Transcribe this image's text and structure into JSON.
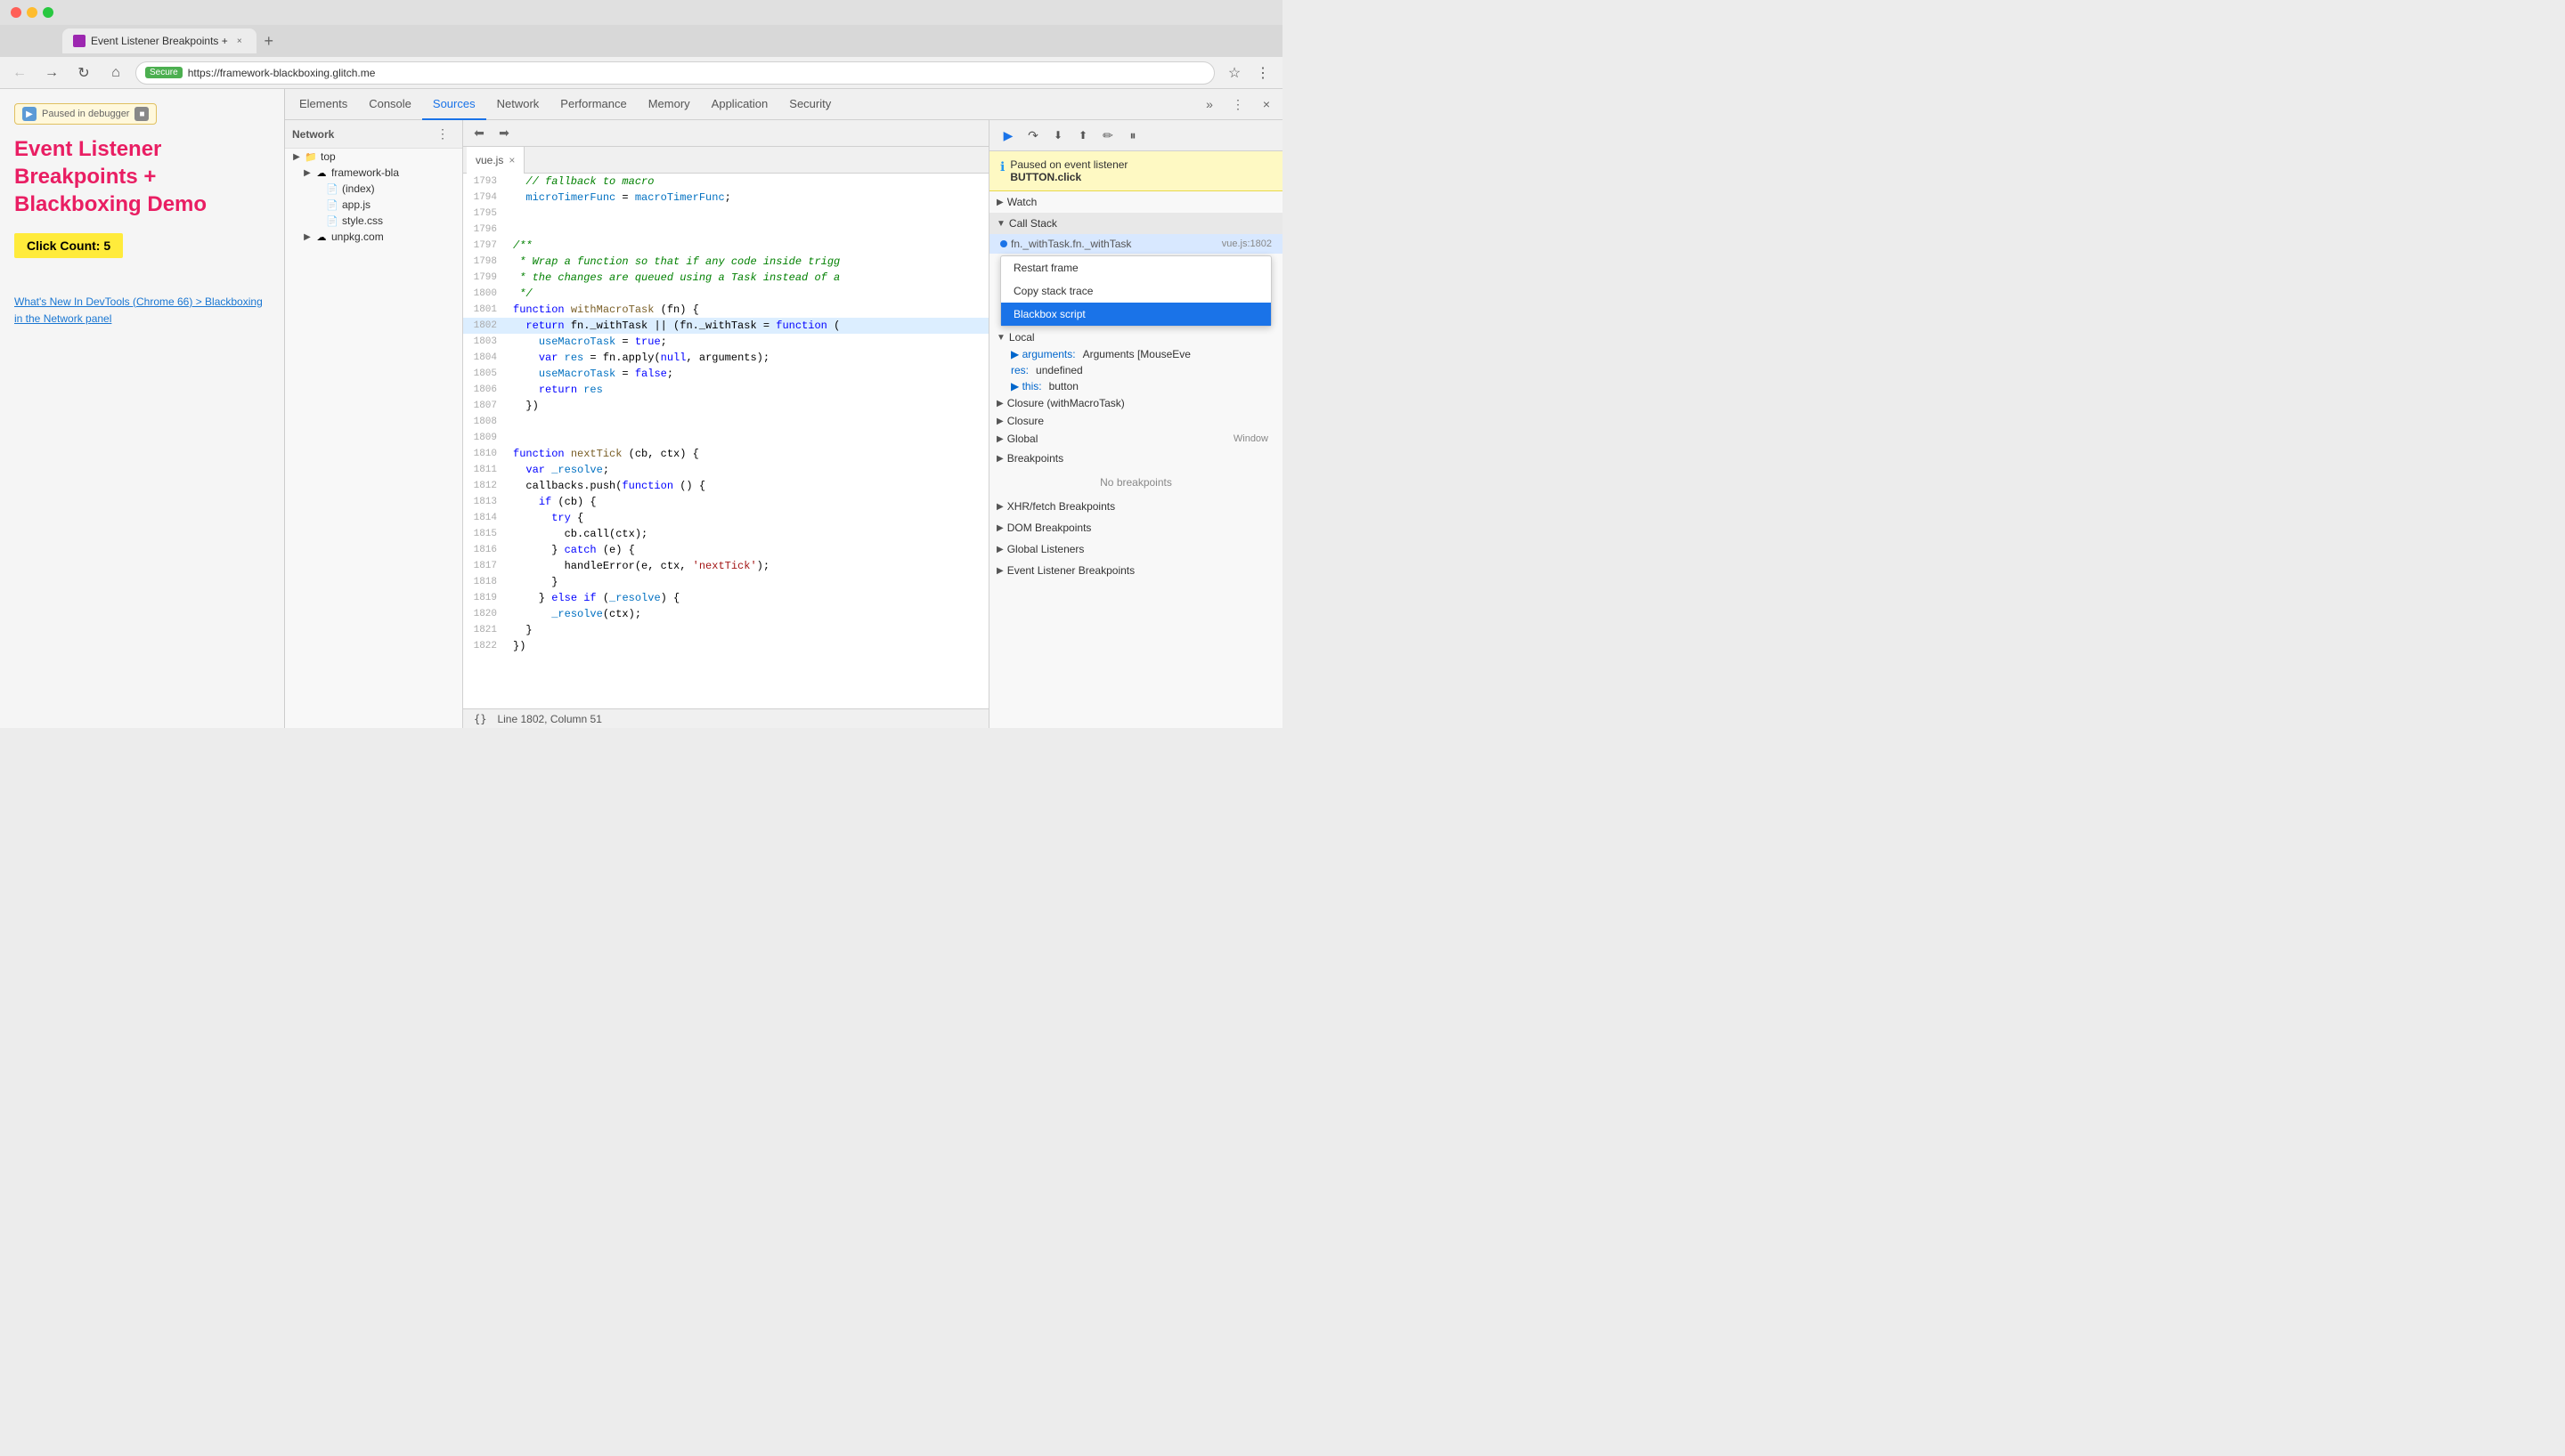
{
  "browser": {
    "tab_title": "Event Listener Breakpoints +",
    "url_secure": "Secure",
    "url": "https://framework-blackboxing.glitch.me",
    "new_tab_label": "+"
  },
  "demo_page": {
    "paused_label": "Paused in debugger",
    "title": "Event Listener Breakpoints + Blackboxing Demo",
    "click_count_label": "Click Count: 5",
    "link1": "What's New In DevTools (Chrome 66) > Blackboxing in the Network panel",
    "link2": ""
  },
  "devtools_tabs": {
    "items": [
      "Elements",
      "Console",
      "Sources",
      "Network",
      "Performance",
      "Memory",
      "Application",
      "Security"
    ],
    "active": "Sources"
  },
  "sources": {
    "network_label": "Network",
    "sidebar_items": [
      {
        "label": "top",
        "indent": 0,
        "arrow": "▶",
        "icon": "📁",
        "type": "folder"
      },
      {
        "label": "framework-bla",
        "indent": 1,
        "arrow": "▶",
        "icon": "☁",
        "type": "cloud"
      },
      {
        "label": "(index)",
        "indent": 2,
        "arrow": "",
        "icon": "📄",
        "type": "file"
      },
      {
        "label": "app.js",
        "indent": 2,
        "arrow": "",
        "icon": "📄",
        "type": "file"
      },
      {
        "label": "style.css",
        "indent": 2,
        "arrow": "",
        "icon": "📄",
        "type": "file"
      },
      {
        "label": "unpkg.com",
        "indent": 1,
        "arrow": "▶",
        "icon": "☁",
        "type": "cloud-closed"
      }
    ],
    "editor_tab": "vue.js",
    "code_lines": [
      {
        "num": "1793",
        "content": "  // fallback to macro",
        "type": "comment"
      },
      {
        "num": "1794",
        "content": "  microTimerFunc = macroTimerFunc;",
        "type": "normal"
      },
      {
        "num": "1795",
        "content": "",
        "type": "normal"
      },
      {
        "num": "1796",
        "content": "",
        "type": "normal"
      },
      {
        "num": "1797",
        "content": "/**",
        "type": "comment"
      },
      {
        "num": "1798",
        "content": " * Wrap a function so that if any code inside trigg",
        "type": "comment"
      },
      {
        "num": "1799",
        "content": " * the changes are queued using a Task instead of a",
        "type": "comment"
      },
      {
        "num": "1800",
        "content": " */",
        "type": "comment"
      },
      {
        "num": "1801",
        "content": "function withMacroTask (fn) {",
        "type": "normal"
      },
      {
        "num": "1802",
        "content": "  return fn._withTask || (fn._withTask = function (",
        "type": "highlighted"
      },
      {
        "num": "1803",
        "content": "    useMacroTask = true;",
        "type": "normal"
      },
      {
        "num": "1804",
        "content": "    var res = fn.apply(null, arguments);",
        "type": "normal"
      },
      {
        "num": "1805",
        "content": "    useMacroTask = false;",
        "type": "normal"
      },
      {
        "num": "1806",
        "content": "    return res",
        "type": "normal"
      },
      {
        "num": "1807",
        "content": "  })",
        "type": "normal"
      },
      {
        "num": "1808",
        "content": "",
        "type": "normal"
      },
      {
        "num": "1809",
        "content": "",
        "type": "normal"
      },
      {
        "num": "1810",
        "content": "function nextTick (cb, ctx) {",
        "type": "normal"
      },
      {
        "num": "1811",
        "content": "  var _resolve;",
        "type": "normal"
      },
      {
        "num": "1812",
        "content": "  callbacks.push(function () {",
        "type": "normal"
      },
      {
        "num": "1813",
        "content": "    if (cb) {",
        "type": "normal"
      },
      {
        "num": "1814",
        "content": "      try {",
        "type": "normal"
      },
      {
        "num": "1815",
        "content": "        cb.call(ctx);",
        "type": "normal"
      },
      {
        "num": "1816",
        "content": "      } catch (e) {",
        "type": "normal"
      },
      {
        "num": "1817",
        "content": "        handleError(e, ctx, 'nextTick');",
        "type": "normal"
      },
      {
        "num": "1818",
        "content": "      }",
        "type": "normal"
      },
      {
        "num": "1819",
        "content": "    } else if (_resolve) {",
        "type": "normal"
      },
      {
        "num": "1820",
        "content": "      _resolve(ctx);",
        "type": "normal"
      },
      {
        "num": "1821",
        "content": "  }",
        "type": "normal"
      },
      {
        "num": "1822",
        "content": "})",
        "type": "normal"
      }
    ],
    "status_bar": "Line 1802, Column 51",
    "status_icon": "{}"
  },
  "debugger": {
    "paused_title": "Paused on event listener",
    "paused_sub": "BUTTON.click",
    "watch_label": "Watch",
    "call_stack_label": "Call Stack",
    "call_stack_items": [
      {
        "fn": "fn._withTask.fn._withTask",
        "loc": "vue.js:1802",
        "active": true
      }
    ],
    "scope_sections": [
      {
        "label": "Local",
        "open": true,
        "items": [
          {
            "label": "▶ arguments:",
            "value": "Arguments [MouseEve"
          },
          {
            "label": "res:",
            "value": "undefined"
          },
          {
            "label": "▶ this:",
            "value": "button"
          }
        ]
      },
      {
        "label": "Closure (withMacroTask)",
        "open": false,
        "items": []
      },
      {
        "label": "Closure",
        "open": false,
        "items": []
      },
      {
        "label": "Global",
        "open": false,
        "value": "Window"
      }
    ],
    "breakpoints_label": "Breakpoints",
    "no_breakpoints": "No breakpoints",
    "xhr_breakpoints": "XHR/fetch Breakpoints",
    "dom_breakpoints": "DOM Breakpoints",
    "global_listeners": "Global Listeners",
    "event_listener_breakpoints": "Event Listener Breakpoints"
  },
  "context_menu": {
    "items": [
      "Restart frame",
      "Copy stack trace",
      "Blackbox script"
    ],
    "highlighted": "Blackbox script"
  },
  "icons": {
    "back": "←",
    "forward": "→",
    "reload": "↻",
    "home": "⌂",
    "star": "☆",
    "more": "⋮",
    "close": "×",
    "play": "▶",
    "pause": "⏸",
    "step_over": "↷",
    "step_into": "↓",
    "step_out": "↑",
    "deactivate": "⊘",
    "settings": "⚙"
  }
}
